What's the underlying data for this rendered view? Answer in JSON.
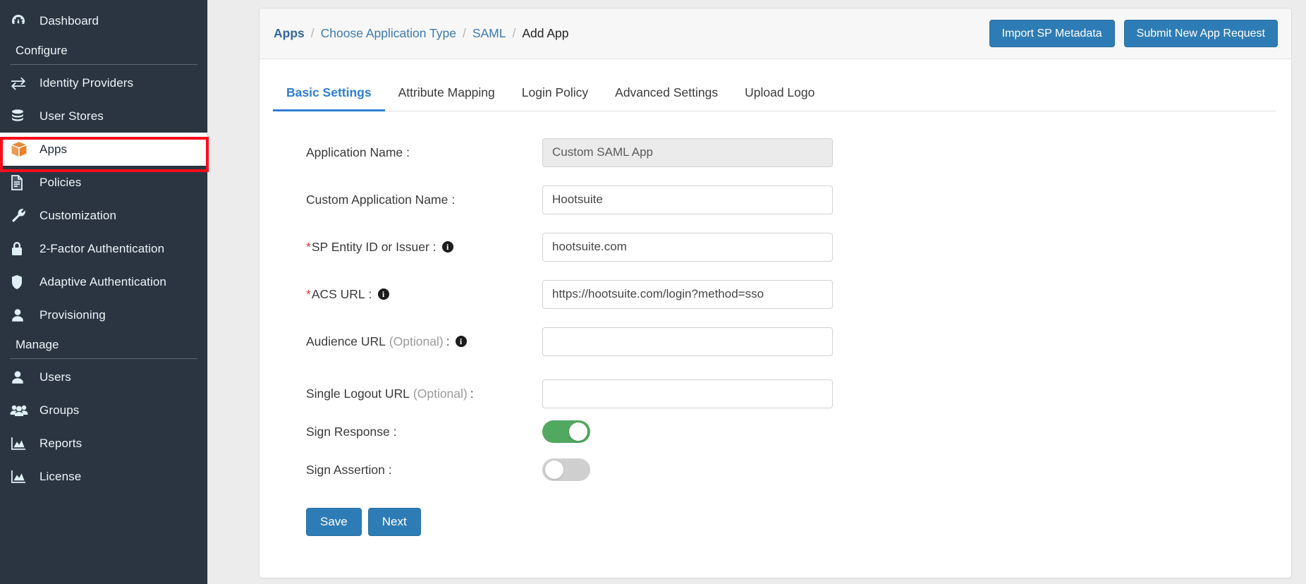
{
  "sidebar": {
    "top_items": [
      {
        "label": "Dashboard",
        "icon": "dashboard-icon"
      }
    ],
    "sections": [
      {
        "title": "Configure",
        "items": [
          {
            "label": "Identity Providers",
            "icon": "exchange-icon",
            "active": false
          },
          {
            "label": "User Stores",
            "icon": "database-icon",
            "active": false
          },
          {
            "label": "Apps",
            "icon": "box-icon",
            "active": true
          },
          {
            "label": "Policies",
            "icon": "document-icon",
            "active": false
          },
          {
            "label": "Customization",
            "icon": "wrench-icon",
            "active": false
          },
          {
            "label": "2-Factor Authentication",
            "icon": "lock-icon",
            "active": false
          },
          {
            "label": "Adaptive Authentication",
            "icon": "shield-icon",
            "active": false
          },
          {
            "label": "Provisioning",
            "icon": "user-icon",
            "active": false
          }
        ]
      },
      {
        "title": "Manage",
        "items": [
          {
            "label": "Users",
            "icon": "user-icon",
            "active": false
          },
          {
            "label": "Groups",
            "icon": "users-group-icon",
            "active": false
          },
          {
            "label": "Reports",
            "icon": "chart-icon",
            "active": false
          },
          {
            "label": "License",
            "icon": "chart-icon",
            "active": false
          }
        ]
      }
    ],
    "highlight": {
      "target": "Apps",
      "color": "#fc0d1b"
    }
  },
  "header": {
    "breadcrumb": [
      {
        "label": "Apps",
        "type": "link-strong"
      },
      {
        "label": "Choose Application Type",
        "type": "link"
      },
      {
        "label": "SAML",
        "type": "link"
      },
      {
        "label": "Add App",
        "type": "current"
      }
    ],
    "separator": "/",
    "buttons": [
      {
        "label": "Import SP Metadata",
        "name": "import-sp-metadata-button"
      },
      {
        "label": "Submit New App Request",
        "name": "submit-new-app-request-button"
      }
    ]
  },
  "tabs": [
    {
      "label": "Basic Settings",
      "active": true
    },
    {
      "label": "Attribute Mapping",
      "active": false
    },
    {
      "label": "Login Policy",
      "active": false
    },
    {
      "label": "Advanced Settings",
      "active": false
    },
    {
      "label": "Upload Logo",
      "active": false
    }
  ],
  "form": {
    "fields": [
      {
        "label": "Application Name",
        "required": false,
        "optional": false,
        "info": false,
        "colon": ":",
        "value": "Custom SAML App",
        "placeholder": "",
        "readonly": true,
        "name": "application-name-field"
      },
      {
        "label": "Custom Application Name",
        "required": false,
        "optional": false,
        "info": false,
        "colon": ":",
        "value": "Hootsuite",
        "placeholder": "",
        "readonly": false,
        "name": "custom-application-name-field"
      },
      {
        "label": "SP Entity ID or Issuer",
        "required": true,
        "optional": false,
        "info": true,
        "colon": ":",
        "value": "hootsuite.com",
        "placeholder": "",
        "readonly": false,
        "name": "sp-entity-id-field"
      },
      {
        "label": "ACS URL",
        "required": true,
        "optional": false,
        "info": true,
        "colon": ":",
        "value": "https://hootsuite.com/login?method=sso",
        "placeholder": "",
        "readonly": false,
        "name": "acs-url-field"
      },
      {
        "label": "Audience URL",
        "required": false,
        "optional": true,
        "optional_text": "(Optional)",
        "info": true,
        "colon": ":",
        "value": "",
        "placeholder": "",
        "readonly": false,
        "name": "audience-url-field"
      },
      {
        "label": "Single Logout URL",
        "required": false,
        "optional": true,
        "optional_text": "(Optional)",
        "info": false,
        "colon": ":",
        "value": "",
        "placeholder": "",
        "readonly": false,
        "name": "single-logout-url-field"
      }
    ],
    "toggles": [
      {
        "label": "Sign Response",
        "colon": ":",
        "on": true,
        "name": "sign-response-toggle",
        "color": "#51a85f"
      },
      {
        "label": "Sign Assertion",
        "colon": ":",
        "on": false,
        "name": "sign-assertion-toggle",
        "color": "#cfcfcf"
      }
    ],
    "actions": [
      {
        "label": "Save",
        "name": "save-button"
      },
      {
        "label": "Next",
        "name": "next-button"
      }
    ]
  },
  "colors": {
    "sidebar_bg": "#2b3542",
    "accent_blue": "#2e7cb5",
    "tab_active": "#2f7dd1",
    "apps_icon_orange": "#e8812a",
    "highlight_red": "#fc0d1b"
  }
}
